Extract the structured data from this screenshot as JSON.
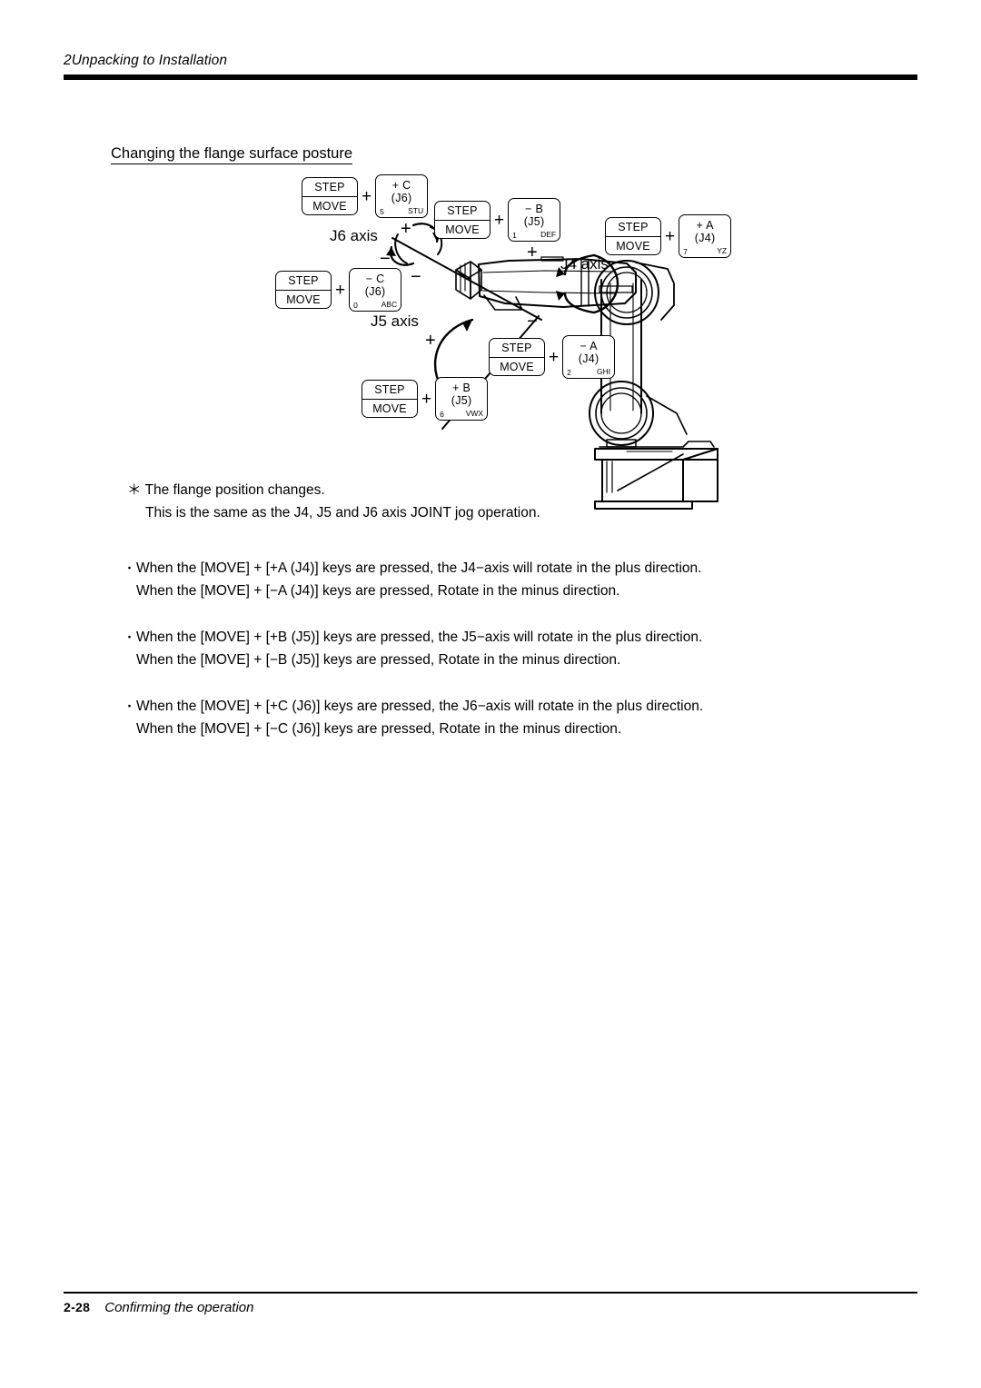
{
  "header": {
    "title": "2Unpacking to Installation"
  },
  "section": {
    "heading": "Changing the flange surface posture"
  },
  "figure": {
    "axis_labels": {
      "j6": "J6 axis",
      "j5": "J5 axis",
      "j4": "J4 axis"
    },
    "direction_signs": {
      "j6_plus": "+",
      "j6_minus": "−",
      "j5_plus": "+",
      "j5_minus": "−",
      "j4_plus": "+",
      "j4_minus": "−"
    },
    "key_combos": [
      {
        "id": "plus-c-j6",
        "step_label": "STEP",
        "move_label": "MOVE",
        "plus": "+",
        "key_line1": "+ C",
        "key_line2": "(J6)",
        "sub_left": "5",
        "sub_right": "STU"
      },
      {
        "id": "minus-b-j5",
        "step_label": "STEP",
        "move_label": "MOVE",
        "plus": "+",
        "key_line1": "− B",
        "key_line2": "(J5)",
        "sub_left": "1",
        "sub_right": "DEF"
      },
      {
        "id": "plus-a-j4",
        "step_label": "STEP",
        "move_label": "MOVE",
        "plus": "+",
        "key_line1": "+ A",
        "key_line2": "(J4)",
        "sub_left": "7",
        "sub_right": "YZ"
      },
      {
        "id": "minus-c-j6",
        "step_label": "STEP",
        "move_label": "MOVE",
        "plus": "+",
        "key_line1": "− C",
        "key_line2": "(J6)",
        "sub_left": "0",
        "sub_right": "ABC"
      },
      {
        "id": "minus-a-j4",
        "step_label": "STEP",
        "move_label": "MOVE",
        "plus": "+",
        "key_line1": "− A",
        "key_line2": "(J4)",
        "sub_left": "2",
        "sub_right": "GHI"
      },
      {
        "id": "plus-b-j5",
        "step_label": "STEP",
        "move_label": "MOVE",
        "plus": "+",
        "key_line1": "+ B",
        "key_line2": "(J5)",
        "sub_left": "6",
        "sub_right": "VWX"
      }
    ]
  },
  "note": {
    "line1": "＊ The flange position changes.",
    "line2": "This is the same as the J4, J5 and J6 axis JOINT jog operation."
  },
  "bullets": [
    {
      "marker": "・",
      "line1": "When the [MOVE] + [+A (J4)] keys are pressed, the J4−axis will rotate in the plus direction.",
      "line2": "When the [MOVE] + [−A (J4)] keys are pressed, Rotate in the minus direction."
    },
    {
      "marker": "・",
      "line1": "When the [MOVE] + [+B (J5)] keys are pressed, the J5−axis will rotate in the plus direction.",
      "line2": "When the [MOVE] + [−B (J5)] keys are pressed, Rotate in the minus direction."
    },
    {
      "marker": "・",
      "line1": "When the [MOVE] + [+C (J6)] keys are pressed, the J6−axis will rotate in the plus direction.",
      "line2": "When the [MOVE] + [−C (J6)] keys are pressed, Rotate in the minus direction."
    }
  ],
  "footer": {
    "page_number": "2-28",
    "text": "Confirming the operation"
  },
  "colors": {
    "ink": "#000000",
    "paper": "#ffffff"
  }
}
